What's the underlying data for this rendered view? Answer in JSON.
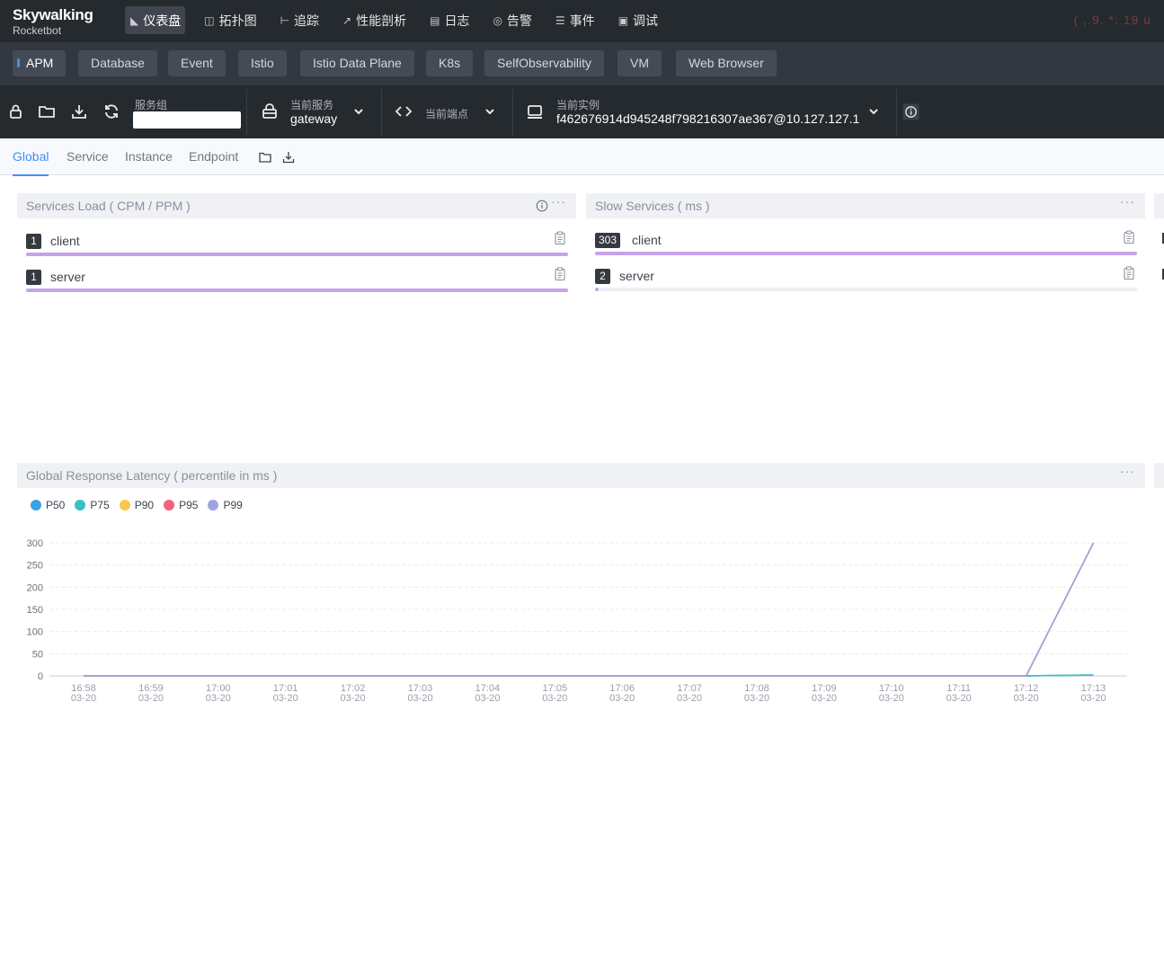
{
  "app": {
    "brand": "Skywalking",
    "sub": "Rocketbot",
    "time": "( ,.9.  *: 19 u"
  },
  "nav": [
    {
      "icon": "dashboard-icon",
      "label": "仪表盘",
      "active": true
    },
    {
      "icon": "topology-icon",
      "label": "拓扑图"
    },
    {
      "icon": "trace-icon",
      "label": "追踪"
    },
    {
      "icon": "profile-icon",
      "label": "性能剖析"
    },
    {
      "icon": "log-icon",
      "label": "日志"
    },
    {
      "icon": "alarm-icon",
      "label": "告警"
    },
    {
      "icon": "event-icon",
      "label": "事件"
    },
    {
      "icon": "debug-icon",
      "label": "调试"
    }
  ],
  "layers": [
    "APM",
    "Database",
    "Event",
    "Istio",
    "Istio Data Plane",
    "K8s",
    "SelfObservability",
    "VM",
    "Web Browser"
  ],
  "toolbar": {
    "group_label": "服务组",
    "group_value": "",
    "service_label": "当前服务",
    "service_value": "gateway",
    "endpoint_label": "当前端点",
    "instance_label": "当前实例",
    "instance_value": "f462676914d945248f798216307ae367@10.127.127.1"
  },
  "dash_tabs": [
    "Global",
    "Service",
    "Instance",
    "Endpoint"
  ],
  "panels": {
    "services_load": {
      "title": "Services Load ( CPM / PPM )",
      "rows": [
        {
          "badge": "1",
          "label": "client",
          "ratio": 1.0
        },
        {
          "badge": "1",
          "label": "server",
          "ratio": 1.0
        }
      ]
    },
    "slow_services": {
      "title": "Slow Services ( ms )",
      "rows": [
        {
          "badge": "303",
          "label": "client",
          "ratio": 1.0
        },
        {
          "badge": "2",
          "label": "server",
          "ratio": 0.0066
        }
      ]
    },
    "latency": {
      "title": "Global Response Latency ( percentile in ms )",
      "more": "···"
    }
  },
  "colors": {
    "accent": "#448dfe",
    "bar": "#c5a3ea"
  },
  "chart_data": {
    "type": "line",
    "title": "Global Response Latency ( percentile in ms )",
    "x": [
      "16:58\n03-20",
      "16:59\n03-20",
      "17:00\n03-20",
      "17:01\n03-20",
      "17:02\n03-20",
      "17:03\n03-20",
      "17:04\n03-20",
      "17:05\n03-20",
      "17:06\n03-20",
      "17:07\n03-20",
      "17:08\n03-20",
      "17:09\n03-20",
      "17:10\n03-20",
      "17:11\n03-20",
      "17:12\n03-20",
      "17:13\n03-20"
    ],
    "ylim": [
      0,
      300
    ],
    "yticks": [
      0,
      50,
      100,
      150,
      200,
      250,
      300
    ],
    "grid": true,
    "legend": "top-left",
    "series": [
      {
        "name": "P50",
        "color": "#3aa0e8",
        "values": [
          0,
          0,
          0,
          0,
          0,
          0,
          0,
          0,
          0,
          0,
          0,
          0,
          0,
          0,
          0,
          2
        ]
      },
      {
        "name": "P75",
        "color": "#37c2c2",
        "values": [
          0,
          0,
          0,
          0,
          0,
          0,
          0,
          0,
          0,
          0,
          0,
          0,
          0,
          0,
          0,
          2
        ]
      },
      {
        "name": "P90",
        "color": "#f7c84a",
        "values": [
          0,
          0,
          0,
          0,
          0,
          0,
          0,
          0,
          0,
          0,
          0,
          0,
          0,
          0,
          0,
          300
        ]
      },
      {
        "name": "P95",
        "color": "#f2637b",
        "values": [
          0,
          0,
          0,
          0,
          0,
          0,
          0,
          0,
          0,
          0,
          0,
          0,
          0,
          0,
          0,
          300
        ]
      },
      {
        "name": "P99",
        "color": "#9ea4e3",
        "values": [
          0,
          0,
          0,
          0,
          0,
          0,
          0,
          0,
          0,
          0,
          0,
          0,
          0,
          0,
          0,
          300
        ]
      }
    ]
  }
}
